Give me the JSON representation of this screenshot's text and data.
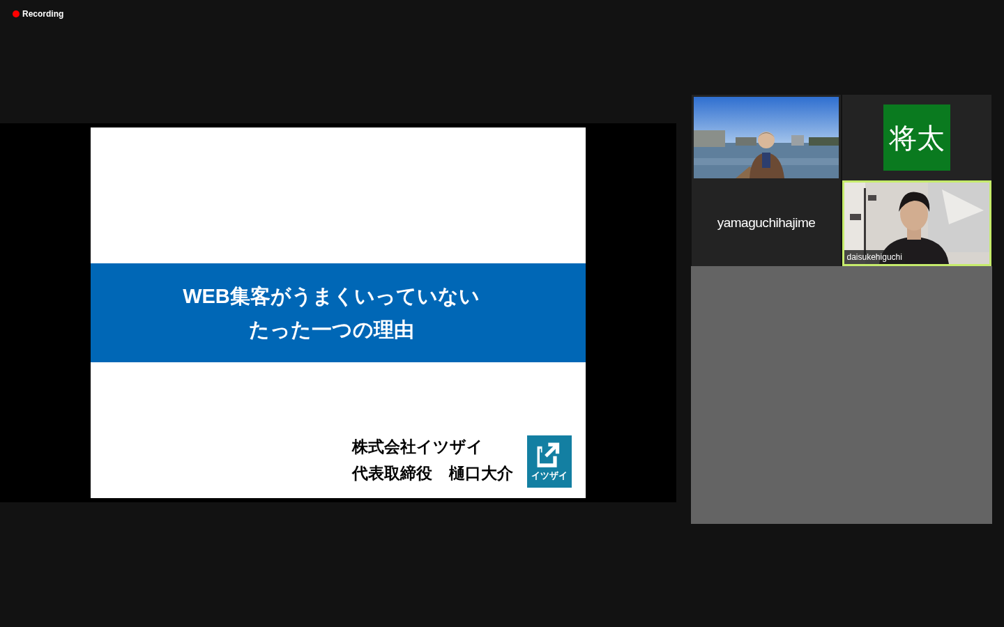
{
  "recording": {
    "label": "Recording",
    "on": true
  },
  "shared_slide": {
    "title_lines": [
      "WEB集客がうまくいっていない",
      "たった一つの理由"
    ],
    "company": "株式会社イツザイ",
    "presenter_role": "代表取締役",
    "presenter_name": "樋口大介",
    "logo_text": "イツザイ"
  },
  "participants": [
    {
      "kind": "video",
      "active_speaker": false
    },
    {
      "kind": "avatar",
      "avatar_text": "将太",
      "color": "#0a7a1f",
      "active_speaker": false
    },
    {
      "kind": "name",
      "name": "yamaguchihajime",
      "active_speaker": false
    },
    {
      "kind": "video",
      "name": "daisukehiguchi",
      "active_speaker": true
    }
  ]
}
